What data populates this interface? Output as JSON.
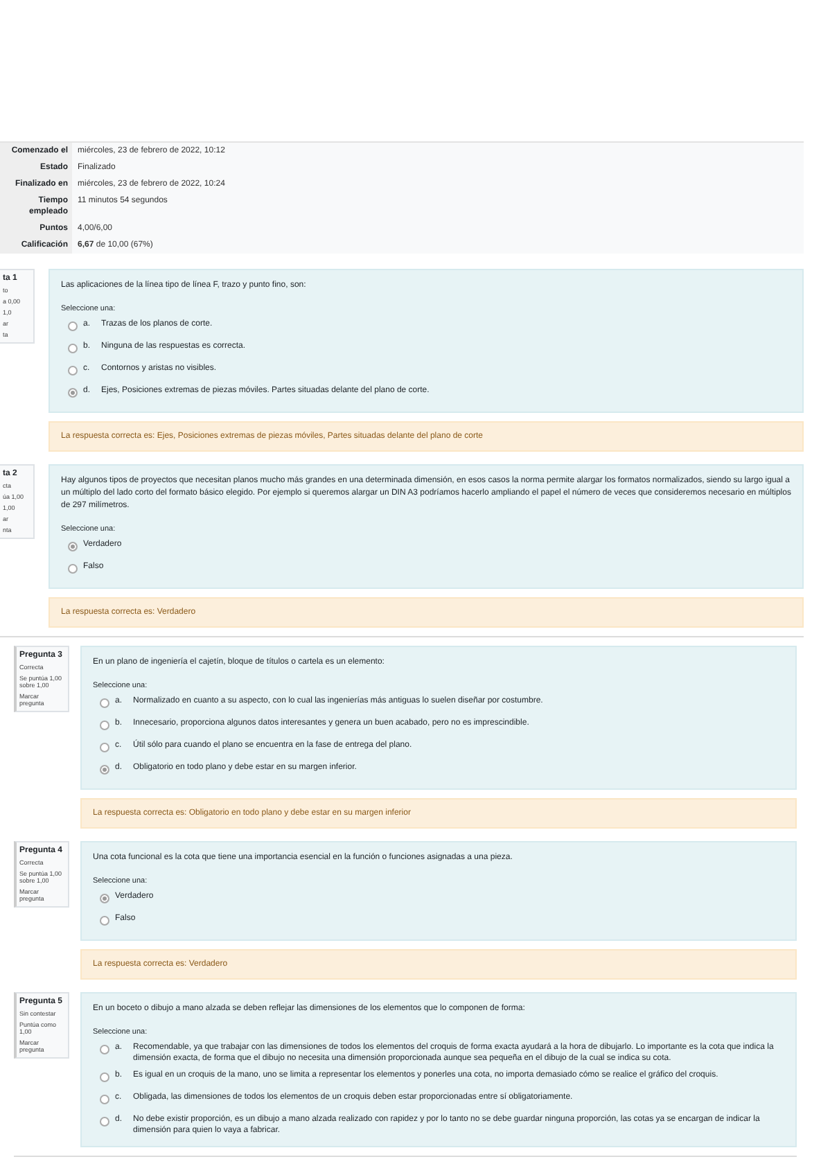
{
  "pages": [
    {
      "summary": [
        {
          "label": "Comenzado el",
          "value": "miércoles, 23 de febrero de 2022, 10:12"
        },
        {
          "label": "Estado",
          "value": "Finalizado"
        },
        {
          "label": "Finalizado en",
          "value": "miércoles, 23 de febrero de 2022, 10:24"
        },
        {
          "label": "Tiempo empleado",
          "value": "11 minutos 54 segundos"
        },
        {
          "label": "Puntos",
          "value": "4,00/6,00"
        },
        {
          "label": "Calificación",
          "value": "**6,67** de 10,00 (67%)"
        }
      ],
      "questions": [
        {
          "info": {
            "title": "ta 1",
            "lines": [
              "to",
              "a 0,00",
              "1,0",
              "ar",
              "ta"
            ]
          },
          "text": "Las aplicaciones de la línea tipo de línea F, trazo y punto fino, son:",
          "prompt": "Seleccione una:",
          "options": [
            {
              "letter": "a.",
              "text": "Trazas de los planos de corte.",
              "selected": false
            },
            {
              "letter": "b.",
              "text": "Ninguna de las respuestas es correcta.",
              "selected": false
            },
            {
              "letter": "c.",
              "text": "Contornos y aristas no visibles.",
              "selected": false
            },
            {
              "letter": "d.",
              "text": "Ejes, Posiciones extremas de piezas móviles. Partes situadas delante del plano de corte.",
              "selected": true
            }
          ],
          "feedback": "La respuesta correcta es: Ejes, Posiciones extremas de piezas móviles, Partes situadas delante del plano de corte"
        },
        {
          "info": {
            "title": "ta 2",
            "lines": [
              "cta",
              "úa 1,00",
              "1,00",
              "ar",
              "nta"
            ]
          },
          "text": "Hay algunos tipos de proyectos que necesitan planos mucho más grandes en una determinada dimensión, en esos casos la norma permite alargar los formatos normalizados, siendo su largo igual a un múltiplo del lado corto del formato básico elegido. Por ejemplo si queremos alargar un DIN A3 podríamos hacerlo ampliando el papel el número de veces que consideremos necesario en múltiplos de 297 milímetros.",
          "prompt": "Seleccione una:",
          "options": [
            {
              "text": "Verdadero",
              "selected": true
            },
            {
              "text": "Falso",
              "selected": false
            }
          ],
          "feedback": "La respuesta correcta es: Verdadero"
        }
      ]
    },
    {
      "questions": [
        {
          "info": {
            "title": "Pregunta 3",
            "lines": [
              "Correcta",
              "Se puntúa 1,00 sobre 1,00",
              "Marcar pregunta"
            ]
          },
          "text": "En un plano de ingeniería el cajetín, bloque de títulos o cartela es un elemento:",
          "prompt": "Seleccione una:",
          "options": [
            {
              "letter": "a.",
              "text": "Normalizado en cuanto a su aspecto, con lo cual las ingenierías más antiguas lo suelen diseñar por costumbre.",
              "selected": false
            },
            {
              "letter": "b.",
              "text": "Innecesario, proporciona algunos datos interesantes y genera un buen acabado, pero no es imprescindible.",
              "selected": false
            },
            {
              "letter": "c.",
              "text": "Útil sólo para cuando el plano se encuentra en la fase de entrega del plano.",
              "selected": false
            },
            {
              "letter": "d.",
              "text": "Obligatorio en todo plano y debe estar en su margen inferior.",
              "selected": true
            }
          ],
          "feedback": "La respuesta correcta es: Obligatorio en todo plano y debe estar en su margen inferior"
        },
        {
          "info": {
            "title": "Pregunta 4",
            "lines": [
              "Correcta",
              "Se puntúa 1,00 sobre 1,00",
              "Marcar pregunta"
            ]
          },
          "text": "Una cota funcional es la cota que tiene una importancia esencial en la función o funciones asignadas a una pieza.",
          "prompt": "Seleccione una:",
          "options": [
            {
              "text": "Verdadero",
              "selected": true
            },
            {
              "text": "Falso",
              "selected": false
            }
          ],
          "feedback": "La respuesta correcta es: Verdadero"
        },
        {
          "info": {
            "title": "Pregunta 5",
            "lines": [
              "Sin contestar",
              "Puntúa como 1,00",
              "Marcar pregunta"
            ]
          },
          "text": "En un boceto o dibujo a mano alzada se deben reflejar las dimensiones de los elementos que lo componen de forma:",
          "prompt": "Seleccione una:",
          "options": [
            {
              "letter": "a.",
              "text": "Recomendable, ya que trabajar con las dimensiones de todos los elementos del croquis de forma exacta ayudará a la hora de dibujarlo. Lo importante es la cota que indica la dimensión exacta, de forma que el dibujo no necesita una dimensión proporcionada aunque sea pequeña en el dibujo de la cual se indica su cota.",
              "selected": false
            },
            {
              "letter": "b.",
              "text": "Es igual en un croquis de la mano, uno se limita a representar los elementos y ponerles una cota, no importa demasiado cómo se realice el gráfico del croquis.",
              "selected": false
            },
            {
              "letter": "c.",
              "text": "Obligada, las dimensiones de todos los elementos de un croquis deben estar proporcionadas entre sí obligatoriamente.",
              "selected": false
            },
            {
              "letter": "d.",
              "text": "No debe existir proporción, es un dibujo a mano alzada realizado con rapidez y por lo tanto no se debe guardar ninguna proporción, las cotas ya se encargan de indicar la dimensión para quien lo vaya a fabricar.",
              "selected": false
            }
          ]
        }
      ]
    }
  ]
}
